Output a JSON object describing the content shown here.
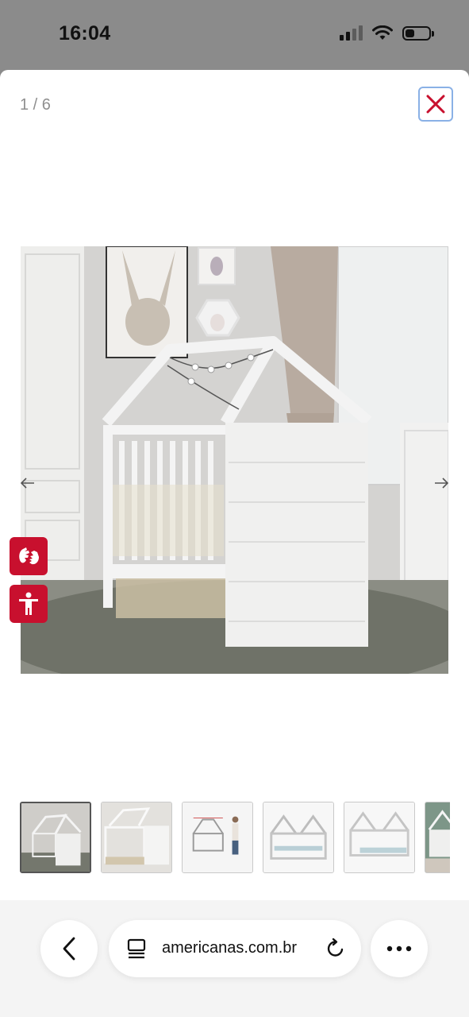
{
  "status_bar": {
    "time": "16:04",
    "signal_bars_filled": 2,
    "signal_bars_total": 4,
    "battery_level": 0.35
  },
  "gallery": {
    "counter": "1 / 6",
    "close_icon": "close-x-icon",
    "accent_color": "#c8102e",
    "main_image": "white-house-frame-crib-photo",
    "thumbnails": [
      {
        "name": "crib-room-photo",
        "active": true
      },
      {
        "name": "crib-closeup-photo",
        "active": false
      },
      {
        "name": "crib-dimensions-photo",
        "active": false
      },
      {
        "name": "crib-front-render",
        "active": false
      },
      {
        "name": "crib-toddler-bed-render",
        "active": false
      },
      {
        "name": "crib-green-room-photo",
        "active": false
      }
    ]
  },
  "accessibility": {
    "sign_language_icon": "sign-language-hands-icon",
    "accessibility_icon": "accessibility-person-icon"
  },
  "browser": {
    "url": "americanas.com.br",
    "back_icon": "chevron-left-icon",
    "page_icon": "page-menu-icon",
    "reload_icon": "reload-icon",
    "more_icon": "more-dots-icon"
  }
}
